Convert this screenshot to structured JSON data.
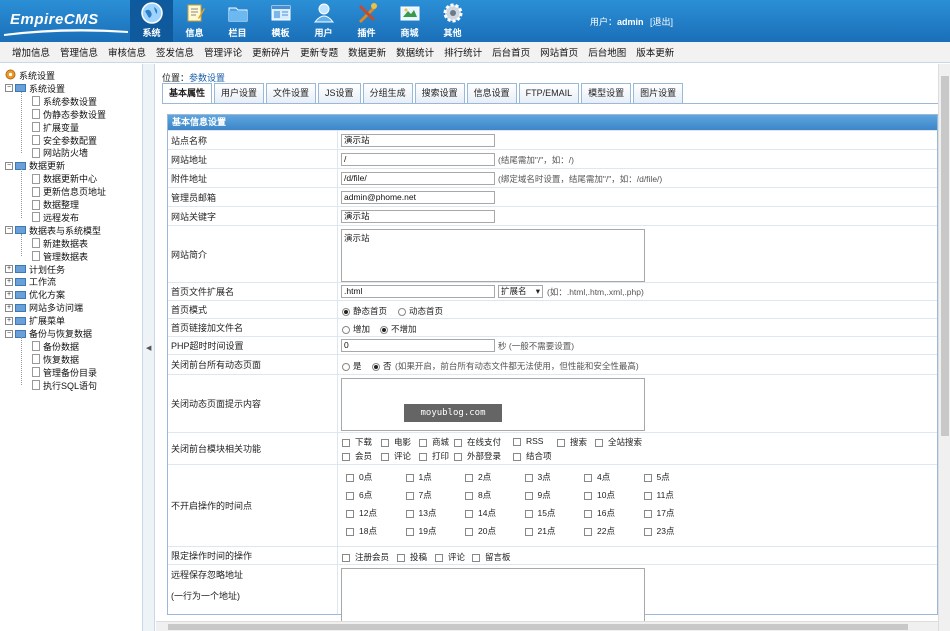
{
  "app": {
    "logo": "EmpireCMS"
  },
  "nav": [
    {
      "label": "系统",
      "icon": "globe-icon",
      "active": true
    },
    {
      "label": "信息",
      "icon": "edit-icon"
    },
    {
      "label": "栏目",
      "icon": "folder-icon"
    },
    {
      "label": "模板",
      "icon": "template-icon"
    },
    {
      "label": "用户",
      "icon": "user-icon"
    },
    {
      "label": "插件",
      "icon": "plugin-icon"
    },
    {
      "label": "商城",
      "icon": "shop-icon"
    },
    {
      "label": "其他",
      "icon": "gear-icon"
    }
  ],
  "user": {
    "prefix": "用户：",
    "name": "admin",
    "logout": "[退出]"
  },
  "submenu": [
    "增加信息",
    "管理信息",
    "审核信息",
    "签发信息",
    "管理评论",
    "更新碎片",
    "更新专题",
    "数据更新",
    "数据统计",
    "排行统计",
    "后台首页",
    "网站首页",
    "后台地图",
    "版本更新"
  ],
  "tree": {
    "root": "系统设置",
    "groups": [
      {
        "label": "系统设置",
        "children": [
          "系统参数设置",
          "伪静态参数设置",
          "扩展变量",
          "安全参数配置",
          "网站防火墙"
        ]
      },
      {
        "label": "数据更新",
        "children": [
          "数据更新中心",
          "更新信息页地址",
          "数据整理",
          "远程发布"
        ]
      },
      {
        "label": "数据表与系统模型",
        "children": [
          "新建数据表",
          "管理数据表"
        ]
      },
      {
        "label": "计划任务",
        "children": []
      },
      {
        "label": "工作流",
        "children": []
      },
      {
        "label": "优化方案",
        "children": []
      },
      {
        "label": "网站多访问端",
        "children": []
      },
      {
        "label": "扩展菜单",
        "children": []
      },
      {
        "label": "备份与恢复数据",
        "children": [
          "备份数据",
          "恢复数据",
          "管理备份目录",
          "执行SQL语句"
        ]
      }
    ]
  },
  "breadcrumb": {
    "prefix": "位置：",
    "link": "参数设置"
  },
  "tabs": [
    "基本属性",
    "用户设置",
    "文件设置",
    "JS设置",
    "分组生成",
    "搜索设置",
    "信息设置",
    "FTP/EMAIL",
    "模型设置",
    "图片设置"
  ],
  "form": {
    "title": "基本信息设置",
    "site_name": {
      "label": "站点名称",
      "value": "演示站"
    },
    "site_url": {
      "label": "网站地址",
      "value": "/",
      "hint": "(结尾需加\"/\"，如：/)"
    },
    "attach_url": {
      "label": "附件地址",
      "value": "/d/file/",
      "hint": "(绑定域名时设置，结尾需加\"/\"，如：/d/file/)"
    },
    "admin_email": {
      "label": "管理员邮箱",
      "value": "admin@phome.net"
    },
    "keywords": {
      "label": "网站关键字",
      "value": "演示站"
    },
    "intro": {
      "label": "网站简介",
      "value": "演示站"
    },
    "index_ext": {
      "label": "首页文件扩展名",
      "value": ".html",
      "select": "扩展名",
      "hint": "(如：.html,.htm,.xml,.php)"
    },
    "index_mode": {
      "label": "首页模式",
      "opt1": "静态首页",
      "opt2": "动态首页"
    },
    "index_link": {
      "label": "首页链接加文件名",
      "opt1": "增加",
      "opt2": "不增加"
    },
    "php_timeout": {
      "label": "PHP超时时间设置",
      "value": "0",
      "hint": "秒 (一般不需要设置)"
    },
    "close_dynamic": {
      "label": "关闭前台所有动态页面",
      "opt1": "是",
      "opt2": "否",
      "hint": "(如果开启，前台所有动态文件都无法使用，但性能和安全性最高)"
    },
    "close_tip": {
      "label": "关闭动态页面提示内容"
    },
    "close_modules": {
      "label": "关闭前台模块相关功能",
      "items": [
        "下载",
        "电影",
        "商城",
        "在线支付",
        "RSS",
        "搜索",
        "全站搜索",
        "会员",
        "评论",
        "打印",
        "外部登录",
        "结合项"
      ]
    },
    "no_op_hours": {
      "label": "不开启操作的时间点",
      "hours": [
        "0点",
        "1点",
        "2点",
        "3点",
        "4点",
        "5点",
        "6点",
        "7点",
        "8点",
        "9点",
        "10点",
        "11点",
        "12点",
        "13点",
        "14点",
        "15点",
        "16点",
        "17点",
        "18点",
        "19点",
        "20点",
        "21点",
        "22点",
        "23点"
      ]
    },
    "limit_ops": {
      "label": "限定操作时间的操作",
      "items": [
        "注册会员",
        "投稿",
        "评论",
        "留言板"
      ]
    },
    "remote_ignore": {
      "label": "远程保存忽略地址",
      "sub": "(一行为一个地址)"
    }
  },
  "watermark": "moyublog.com"
}
